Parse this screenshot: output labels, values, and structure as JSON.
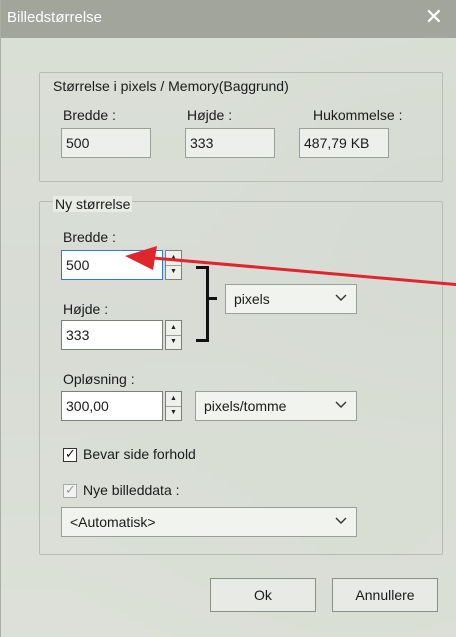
{
  "window": {
    "title": "Billedstørrelse",
    "close_glyph": "✕"
  },
  "current": {
    "group_label": "Størrelse i pixels / Memory(Baggrund)",
    "width_label": "Bredde :",
    "width_value": "500",
    "height_label": "Højde :",
    "height_value": "333",
    "memory_label": "Hukommelse :",
    "memory_value": "487,79 KB"
  },
  "new_size": {
    "group_label": "Ny størrelse",
    "width_label": "Bredde :",
    "width_value": "500",
    "height_label": "Højde :",
    "height_value": "333",
    "unit_selected": "pixels",
    "resolution_label": "Opløsning :",
    "resolution_value": "300,00",
    "resolution_unit_selected": "pixels/tomme",
    "keep_ratio_label": "Bevar side forhold",
    "keep_ratio_checked": true,
    "new_data_label": "Nye billeddata :",
    "new_data_checked": true,
    "new_data_enabled": false,
    "resample_selected": "<Automatisk>"
  },
  "buttons": {
    "ok": "Ok",
    "cancel": "Annullere"
  },
  "icons": {
    "spin_up": "▲",
    "spin_down": "▼",
    "check": "✓"
  },
  "colors": {
    "annotation_arrow": "#e0262d",
    "focus_border": "#2a79d8"
  }
}
